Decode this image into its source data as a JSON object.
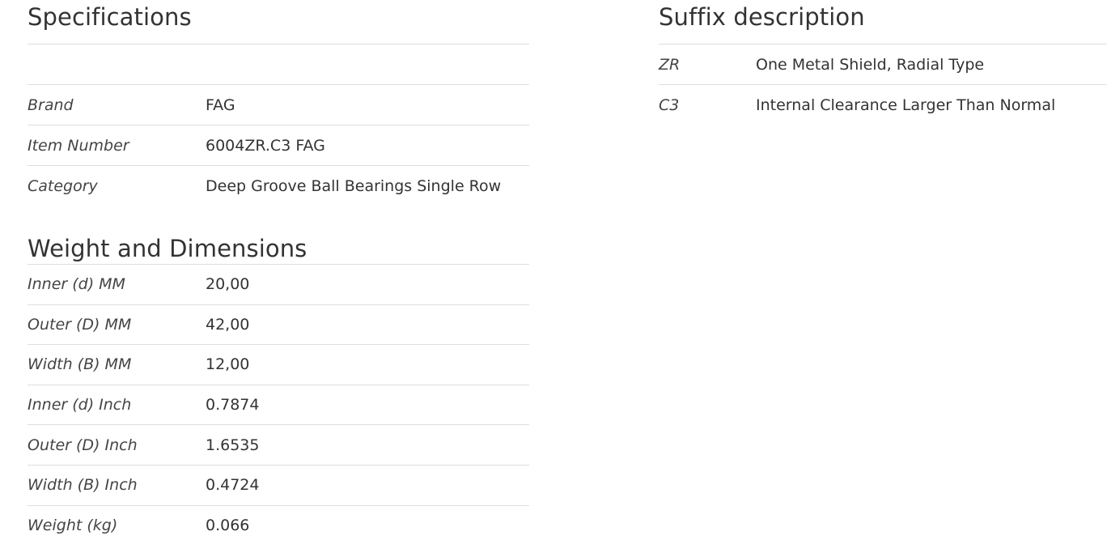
{
  "specifications": {
    "title": "Specifications",
    "rows": [
      {
        "label": "",
        "value": ""
      },
      {
        "label": "Brand",
        "value": "FAG"
      },
      {
        "label": "Item Number",
        "value": "6004ZR.C3 FAG"
      },
      {
        "label": "Category",
        "value": "Deep Groove Ball Bearings Single Row"
      }
    ]
  },
  "weight_dimensions": {
    "title": "Weight and Dimensions",
    "rows": [
      {
        "label": "Inner (d) MM",
        "value": "20,00"
      },
      {
        "label": "Outer (D) MM",
        "value": "42,00"
      },
      {
        "label": "Width (B) MM",
        "value": "12,00"
      },
      {
        "label": "Inner (d) Inch",
        "value": "0.7874"
      },
      {
        "label": "Outer (D) Inch",
        "value": "1.6535"
      },
      {
        "label": "Width (B) Inch",
        "value": "0.4724"
      },
      {
        "label": "Weight (kg)",
        "value": "0.066"
      }
    ]
  },
  "suffix_description": {
    "title": "Suffix description",
    "rows": [
      {
        "label": "ZR",
        "value": "One Metal Shield, Radial Type"
      },
      {
        "label": "C3",
        "value": "Internal Clearance Larger Than Normal"
      }
    ]
  }
}
